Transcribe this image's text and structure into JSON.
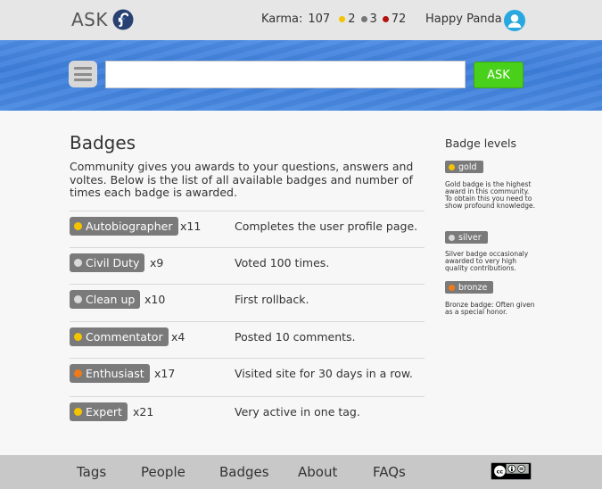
{
  "header": {
    "brand": "ASK",
    "karma_label": "Karma:",
    "karma_value": "107",
    "gold_count": "2",
    "silver_count": "3",
    "bronze_count": "72",
    "username": "Happy Panda"
  },
  "search": {
    "value": "",
    "ask_label": "ASK"
  },
  "main": {
    "title": "Badges",
    "intro": "Community gives you awards to your questions, answers and voltes. Below is the list of all available badges and number of times each badge is awarded.",
    "badges": [
      {
        "name": "Autobiographer",
        "count": "x11",
        "desc": "Completes the user profile page.",
        "level": "gold"
      },
      {
        "name": "Civil Duty",
        "count": "x9",
        "desc": "Voted 100 times.",
        "level": "silver"
      },
      {
        "name": "Clean up",
        "count": "x10",
        "desc": "First rollback.",
        "level": "silver"
      },
      {
        "name": "Commentator",
        "count": "x4",
        "desc": "Posted 10 comments.",
        "level": "gold"
      },
      {
        "name": "Enthusiast",
        "count": "x17",
        "desc": "Visited site for 30 days in a row.",
        "level": "bronze"
      },
      {
        "name": "Expert",
        "count": "x21",
        "desc": "Very active in one tag.",
        "level": "gold"
      }
    ]
  },
  "sidebar": {
    "title": "Badge levels",
    "levels": [
      {
        "name": "gold",
        "desc": "Gold badge is the highest award in this community. To obtain this you need to show profound knowledge."
      },
      {
        "name": "silver",
        "desc": "Silver badge occasionaly awarded to very high quality contributions."
      },
      {
        "name": "bronze",
        "desc": "Bronze badge: Often given as a special honor."
      }
    ]
  },
  "footer": {
    "links": [
      "Tags",
      "People",
      "Badges",
      "About",
      "FAQs"
    ]
  },
  "colors": {
    "gold": "#f5c400",
    "silver": "#d9d9d9",
    "bronze": "#f07a1a",
    "karma_gold": "#f5c400",
    "karma_silver": "#777777",
    "karma_bronze": "#b3120f",
    "ask_button": "#49d01a"
  },
  "icons": {
    "logo": "fedora-logo-icon",
    "avatar": "user-avatar-icon",
    "menu": "hamburger-menu-icon",
    "license": "creative-commons-icon"
  }
}
